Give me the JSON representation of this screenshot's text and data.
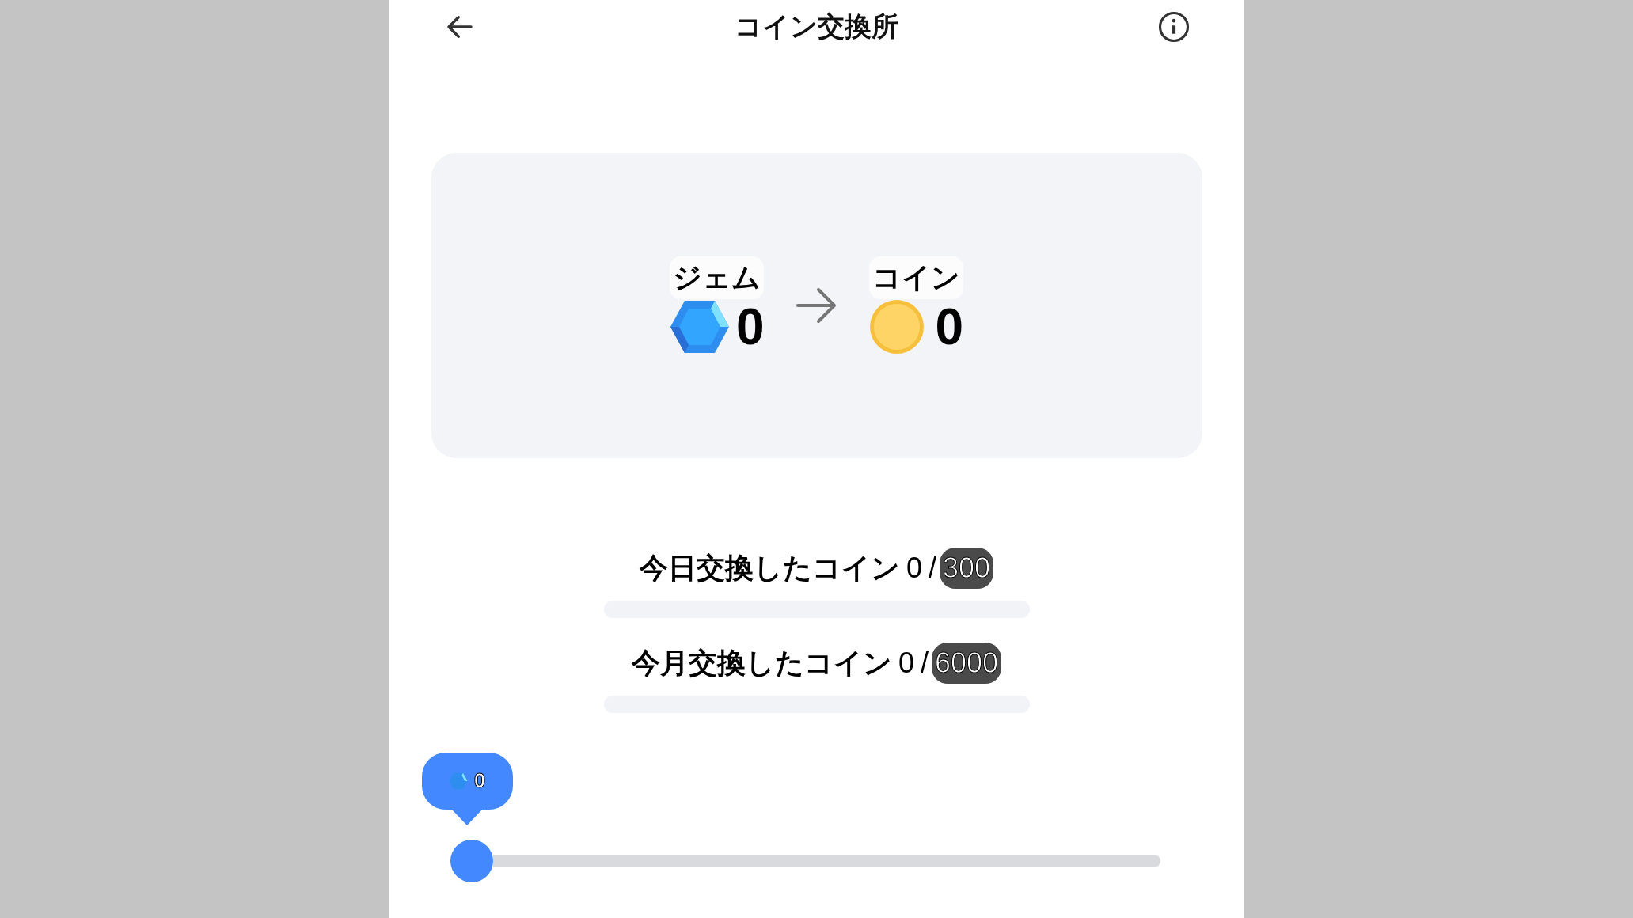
{
  "header": {
    "title": "コイン交換所"
  },
  "exchange": {
    "from": {
      "label": "ジェム",
      "amount": "0"
    },
    "to": {
      "label": "コイン",
      "amount": "0"
    }
  },
  "limits": [
    {
      "label": "今日交換したコイン",
      "count": "0",
      "separator": "/",
      "limit": "300",
      "level": 0
    },
    {
      "label": "今月交換したコイン",
      "count": "0",
      "separator": "/",
      "limit": "6000",
      "level": 0
    }
  ],
  "slider": {
    "tooltip": "0",
    "level": 0
  }
}
